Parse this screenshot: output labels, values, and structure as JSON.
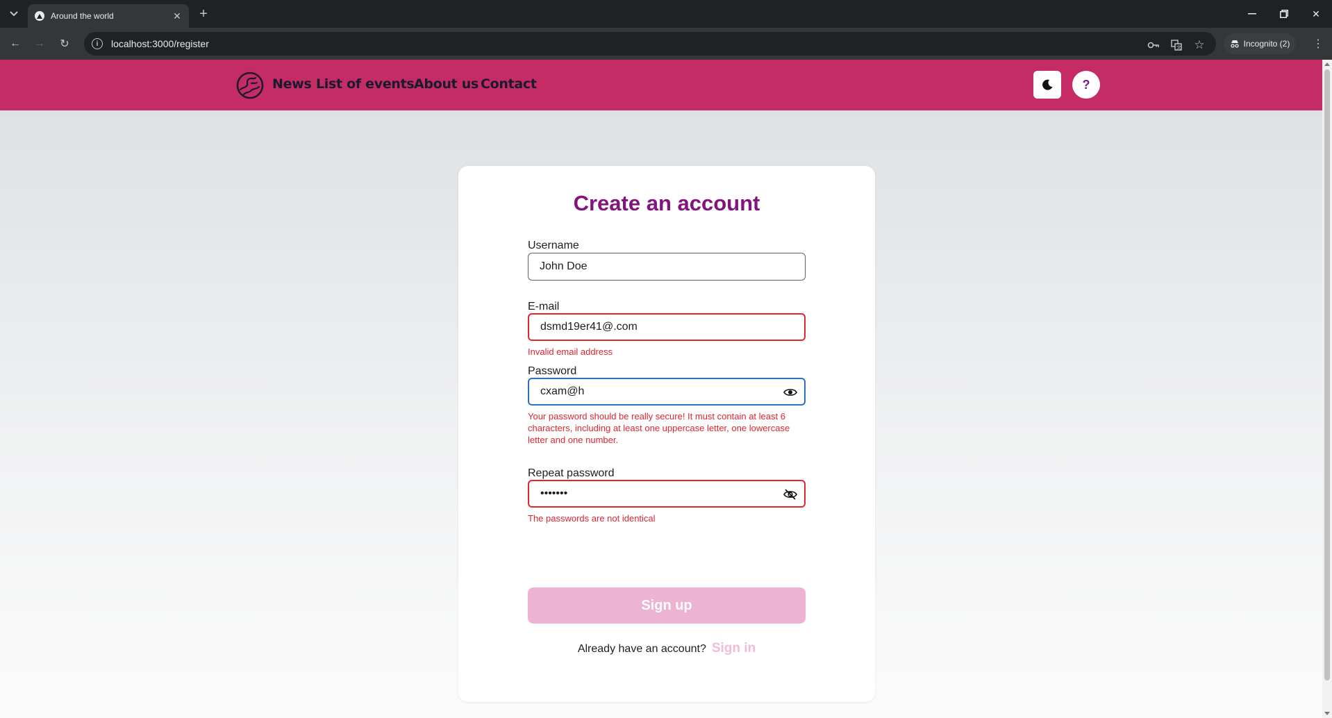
{
  "browser": {
    "tab_title": "Around the world",
    "url": "localhost:3000/register",
    "incognito_label": "Incognito (2)"
  },
  "header": {
    "nav": [
      "News",
      "List of events",
      "About us",
      "Contact"
    ],
    "help_label": "?",
    "brand_color": "#c52c66"
  },
  "form": {
    "title": "Create an account",
    "username": {
      "label": "Username",
      "value": "John Doe"
    },
    "email": {
      "label": "E-mail",
      "value": "dsmd19er41@.com",
      "error": "Invalid email address"
    },
    "password": {
      "label": "Password",
      "value": "cxam@h",
      "error": "Your password should be really secure! It must contain at least 6 characters, including at least one uppercase letter, one lowercase letter and one number."
    },
    "repeat_password": {
      "label": "Repeat password",
      "value": "•••••••",
      "error": "The passwords are not identical"
    },
    "submit_label": "Sign up",
    "signin_prompt": "Already have an account?",
    "signin_link": "Sign in"
  },
  "colors": {
    "title": "#83137d",
    "error": "#e0252f",
    "button_disabled": "#ecb4d2"
  }
}
